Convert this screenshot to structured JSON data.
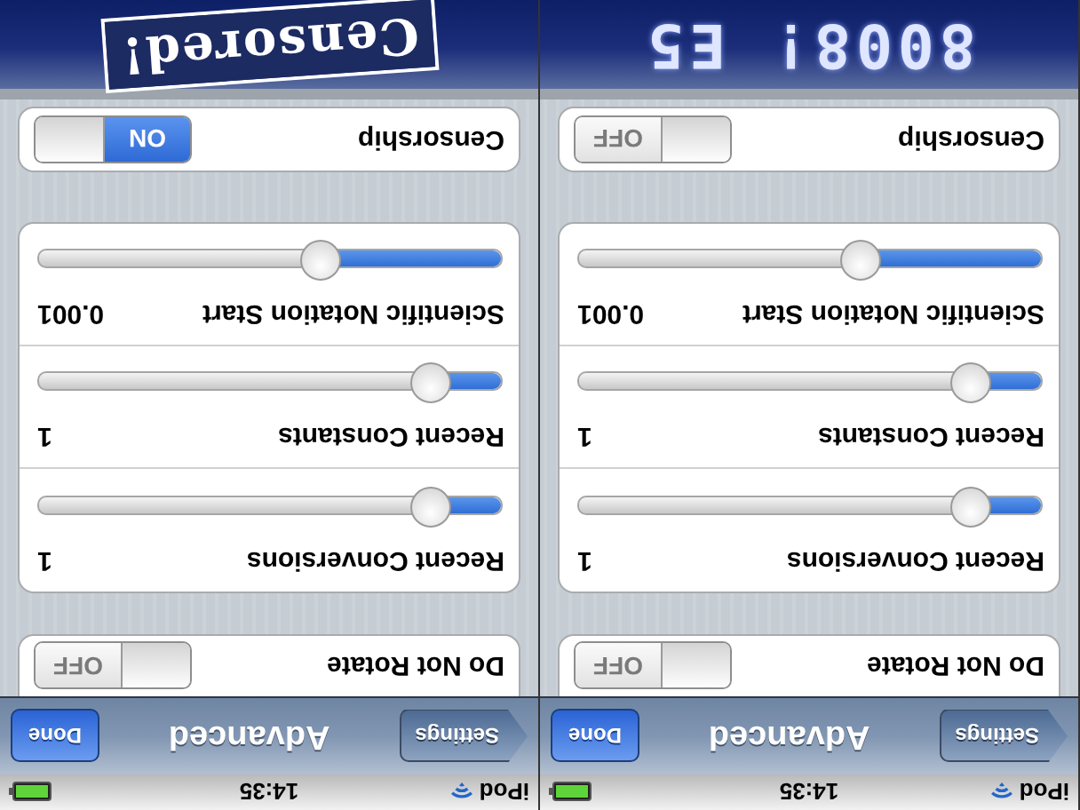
{
  "panels": [
    {
      "status_bar": {
        "carrier": "iPod",
        "time": "14:35"
      },
      "nav_bar": {
        "back": "Settings",
        "title": "Advanced",
        "done": "Done"
      },
      "groups": [
        [
          {
            "kind": "toggle",
            "label": "Do Not Rotate",
            "on": false,
            "switch_text": "OFF"
          }
        ],
        [
          {
            "kind": "slider",
            "label": "Recent Conversions",
            "value": "1",
            "level": 0.12
          },
          {
            "kind": "slider",
            "label": "Recent Constants",
            "value": "1",
            "level": 0.12
          },
          {
            "kind": "slider",
            "label": "Scientific Notation Start",
            "value": "0.001",
            "level": 0.38
          }
        ],
        [
          {
            "kind": "toggle",
            "label": "Censorship",
            "on": true,
            "switch_text": "ON"
          }
        ]
      ],
      "header": {
        "kind": "stamp",
        "text": "Censored!"
      }
    },
    {
      "status_bar": {
        "carrier": "iPod",
        "time": "14:35"
      },
      "nav_bar": {
        "back": "Settings",
        "title": "Advanced",
        "done": "Done"
      },
      "groups": [
        [
          {
            "kind": "toggle",
            "label": "Do Not Rotate",
            "on": false,
            "switch_text": "OFF"
          }
        ],
        [
          {
            "kind": "slider",
            "label": "Recent Conversions",
            "value": "1",
            "level": 0.12
          },
          {
            "kind": "slider",
            "label": "Recent Constants",
            "value": "1",
            "level": 0.12
          },
          {
            "kind": "slider",
            "label": "Scientific Notation Start",
            "value": "0.001",
            "level": 0.38
          }
        ],
        [
          {
            "kind": "toggle",
            "label": "Censorship",
            "on": false,
            "switch_text": "OFF"
          }
        ]
      ],
      "header": {
        "kind": "lcd",
        "text": "8008! E5"
      }
    }
  ]
}
